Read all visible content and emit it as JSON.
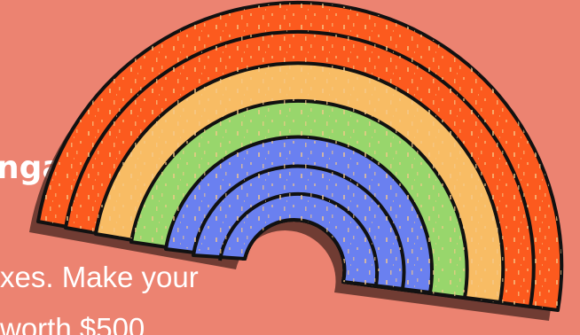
{
  "headline": "nga",
  "body": {
    "line_1": "xes. Make your",
    "line_2": "worth $500"
  },
  "rainbow": {
    "icon": "rainbow-illustration",
    "band_colors": [
      "#fc5a1e",
      "#fc5a1e",
      "#f8bc64",
      "#98d66c",
      "#6a80f0",
      "#6a80f0"
    ],
    "outline_color": "#111111",
    "shadow_color": "#5a3028"
  },
  "background_color": "#ec8371"
}
